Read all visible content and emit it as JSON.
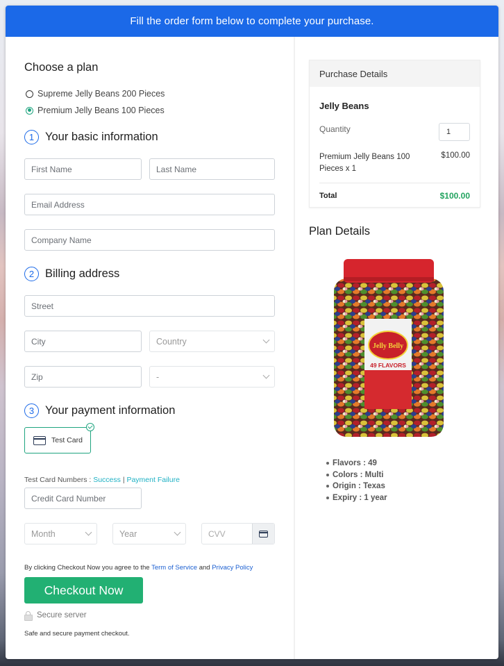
{
  "banner": {
    "text": "Fill the order form below to complete your purchase."
  },
  "plan": {
    "heading": "Choose a plan",
    "options": [
      {
        "label": "Supreme Jelly Beans 200 Pieces",
        "selected": false
      },
      {
        "label": "Premium Jelly Beans 100 Pieces",
        "selected": true
      }
    ]
  },
  "basic": {
    "step": "1",
    "heading": "Your basic information",
    "first_name_placeholder": "First Name",
    "last_name_placeholder": "Last Name",
    "email_placeholder": "Email Address",
    "company_placeholder": "Company Name"
  },
  "billing": {
    "step": "2",
    "heading": "Billing address",
    "street_placeholder": "Street",
    "city_placeholder": "City",
    "country_selected": "Country",
    "zip_placeholder": "Zip",
    "state_selected": "-"
  },
  "payment": {
    "step": "3",
    "heading": "Your payment information",
    "method_label": "Test Card",
    "test_numbers_label": "Test Card Numbers :",
    "success_link": "Success",
    "separator": "|",
    "failure_link": "Payment Failure",
    "card_number_placeholder": "Credit Card Number",
    "month_selected": "Month",
    "year_selected": "Year",
    "cvv_placeholder": "CVV"
  },
  "agreement": {
    "prefix": "By clicking Checkout Now you agree to the",
    "terms_link": "Term of Service",
    "and": "and",
    "privacy_link": "Privacy Policy"
  },
  "checkout": {
    "button_label": "Checkout Now",
    "secure_label": "Secure server",
    "safe_text": "Safe and secure payment checkout."
  },
  "purchase": {
    "heading": "Purchase Details",
    "product": "Jelly Beans",
    "quantity_label": "Quantity",
    "quantity_value": "1",
    "line_item": "Premium Jelly Beans 100 Pieces x 1",
    "line_price": "$100.00",
    "total_label": "Total",
    "total_value": "$100.00"
  },
  "plan_details": {
    "heading": "Plan Details",
    "image_alt": "Jelly Belly 49 Flavors jar",
    "label_brand": "Jelly Belly",
    "label_flavors": "49 FLAVORS",
    "features": [
      "Flavors : 49",
      "Colors : Multi",
      "Origin : Texas",
      "Expiry : 1 year"
    ]
  },
  "colors": {
    "accent_blue": "#1b69e8",
    "accent_green": "#22b073",
    "total_green": "#22a35f",
    "link_teal": "#1fb1c4"
  }
}
